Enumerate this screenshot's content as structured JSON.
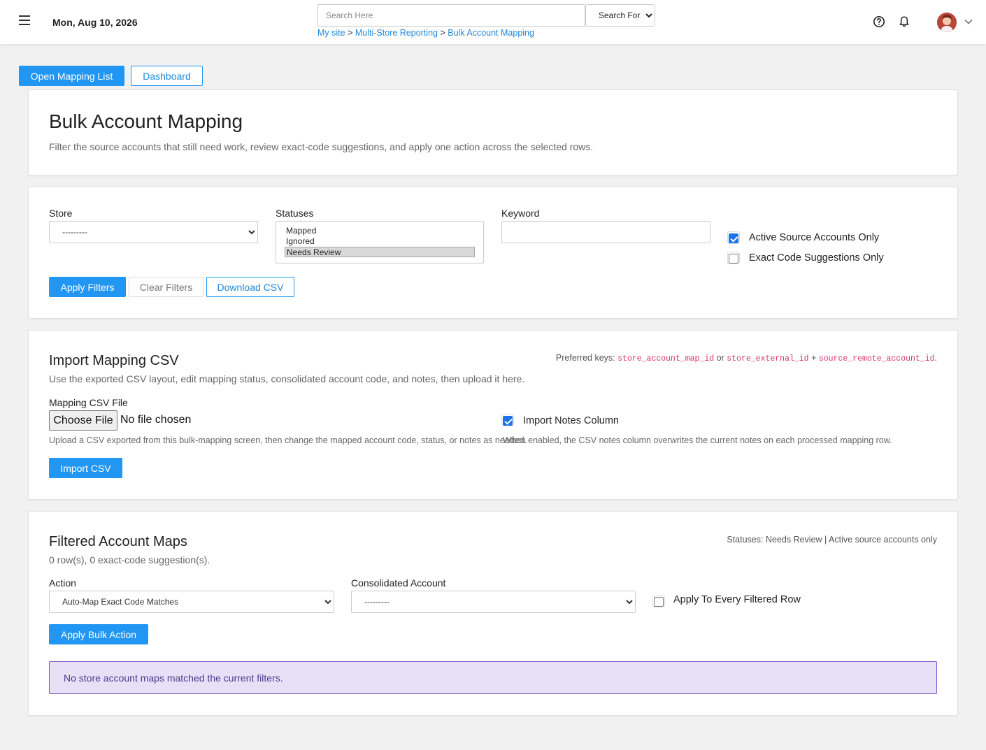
{
  "header": {
    "date": "Mon, Aug 10, 2026",
    "search_placeholder": "Search Here",
    "search_select": "Search For...",
    "breadcrumb": [
      "My site",
      "Multi-Store Reporting",
      "Bulk Account Mapping"
    ],
    "breadcrumb_sep": ">"
  },
  "toolbar": {
    "open_mapping_list": "Open Mapping List",
    "dashboard": "Dashboard"
  },
  "intro": {
    "title": "Bulk Account Mapping",
    "description": "Filter the source accounts that still need work, review exact-code suggestions, and apply one action across the selected rows."
  },
  "filters": {
    "store_label": "Store",
    "store_value": "---------",
    "statuses_label": "Statuses",
    "status_options": [
      "Mapped",
      "Ignored",
      "Needs Review"
    ],
    "selected_status": "Needs Review",
    "keyword_label": "Keyword",
    "keyword_value": "",
    "active_only_label": "Active Source Accounts Only",
    "active_only_checked": true,
    "exact_code_label": "Exact Code Suggestions Only",
    "exact_code_checked": false,
    "apply_label": "Apply Filters",
    "clear_label": "Clear Filters",
    "download_label": "Download CSV"
  },
  "import": {
    "title": "Import Mapping CSV",
    "description": "Use the exported CSV layout, edit mapping status, consolidated account code, and notes, then upload it here.",
    "preferred_keys_prefix": "Preferred keys:",
    "key1": "store_account_map_id",
    "or_text": "or",
    "key2": "store_external_id",
    "plus_text": "+",
    "key3": "source_remote_account_id",
    "period": ".",
    "file_label": "Mapping CSV File",
    "file_button": "Choose File",
    "file_status": "No file chosen",
    "file_help": "Upload a CSV exported from this bulk-mapping screen, then change the mapped account code, status, or notes as needed.",
    "notes_label": "Import Notes Column",
    "notes_checked": true,
    "notes_help": "When enabled, the CSV notes column overwrites the current notes on each processed mapping row.",
    "import_button": "Import CSV"
  },
  "results": {
    "title": "Filtered Account Maps",
    "summary": "0 row(s), 0 exact-code suggestion(s).",
    "filter_summary": "Statuses: Needs Review | Active source accounts only",
    "action_label": "Action",
    "action_value": "Auto-Map Exact Code Matches",
    "consolidated_label": "Consolidated Account",
    "consolidated_value": "---------",
    "apply_all_label": "Apply To Every Filtered Row",
    "apply_all_checked": false,
    "bulk_button": "Apply Bulk Action",
    "empty_message": "No store account maps matched the current filters."
  },
  "colors": {
    "primary": "#2196f3",
    "link": "#2188d8",
    "alert_bg": "#e7e1f7",
    "alert_border": "#7b56c4",
    "code": "#d6336c"
  }
}
